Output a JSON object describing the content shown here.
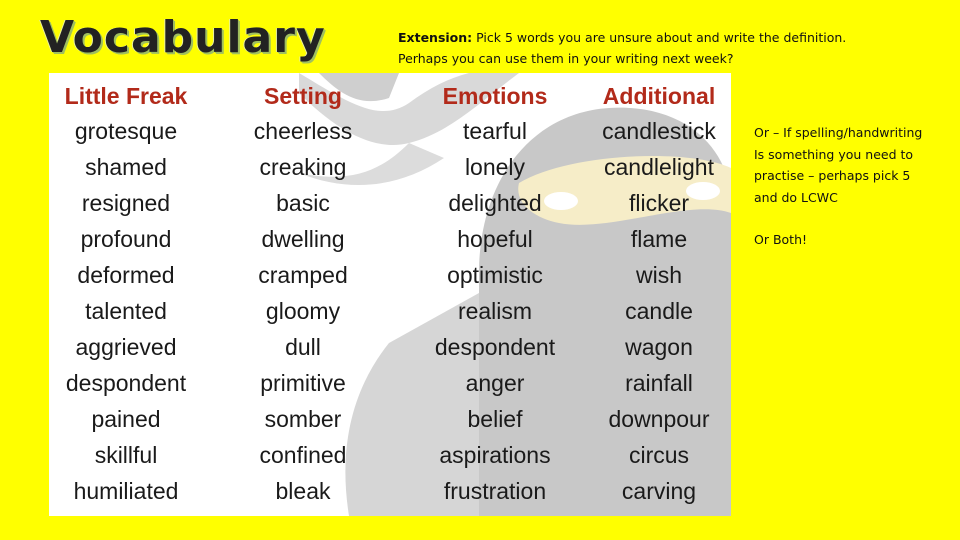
{
  "title": "Vocabulary",
  "extension": {
    "label": "Extension:",
    "line1": " Pick 5 words you are unsure about and write the definition.",
    "line2": "Perhaps you can use them in your writing next week?"
  },
  "side_note": {
    "lines": [
      "Or – If spelling/handwriting",
      "Is something you need to",
      "practise – perhaps pick 5",
      "and do LCWC"
    ],
    "closing": "Or Both!"
  },
  "vocab_table": {
    "header_color": "#b22a1a",
    "watermark": "ninja-face",
    "columns": [
      {
        "heading": "Little Freak",
        "words": [
          "grotesque",
          "shamed",
          "resigned",
          "profound",
          "deformed",
          "talented",
          "aggrieved",
          "despondent",
          "pained",
          "skillful",
          "humiliated"
        ]
      },
      {
        "heading": "Setting",
        "words": [
          "cheerless",
          "creaking",
          "basic",
          "dwelling",
          "cramped",
          "gloomy",
          "dull",
          "primitive",
          "somber",
          "confined",
          "bleak"
        ]
      },
      {
        "heading": "Emotions",
        "words": [
          "tearful",
          "lonely",
          "delighted",
          "hopeful",
          "optimistic",
          "realism",
          "despondent",
          "anger",
          "belief",
          "aspirations",
          "frustration"
        ]
      },
      {
        "heading": "Additional",
        "words": [
          "candlestick",
          "candlelight",
          "flicker",
          "flame",
          "wish",
          "candle",
          "wagon",
          "rainfall",
          "downpour",
          "circus",
          "carving"
        ]
      }
    ]
  }
}
